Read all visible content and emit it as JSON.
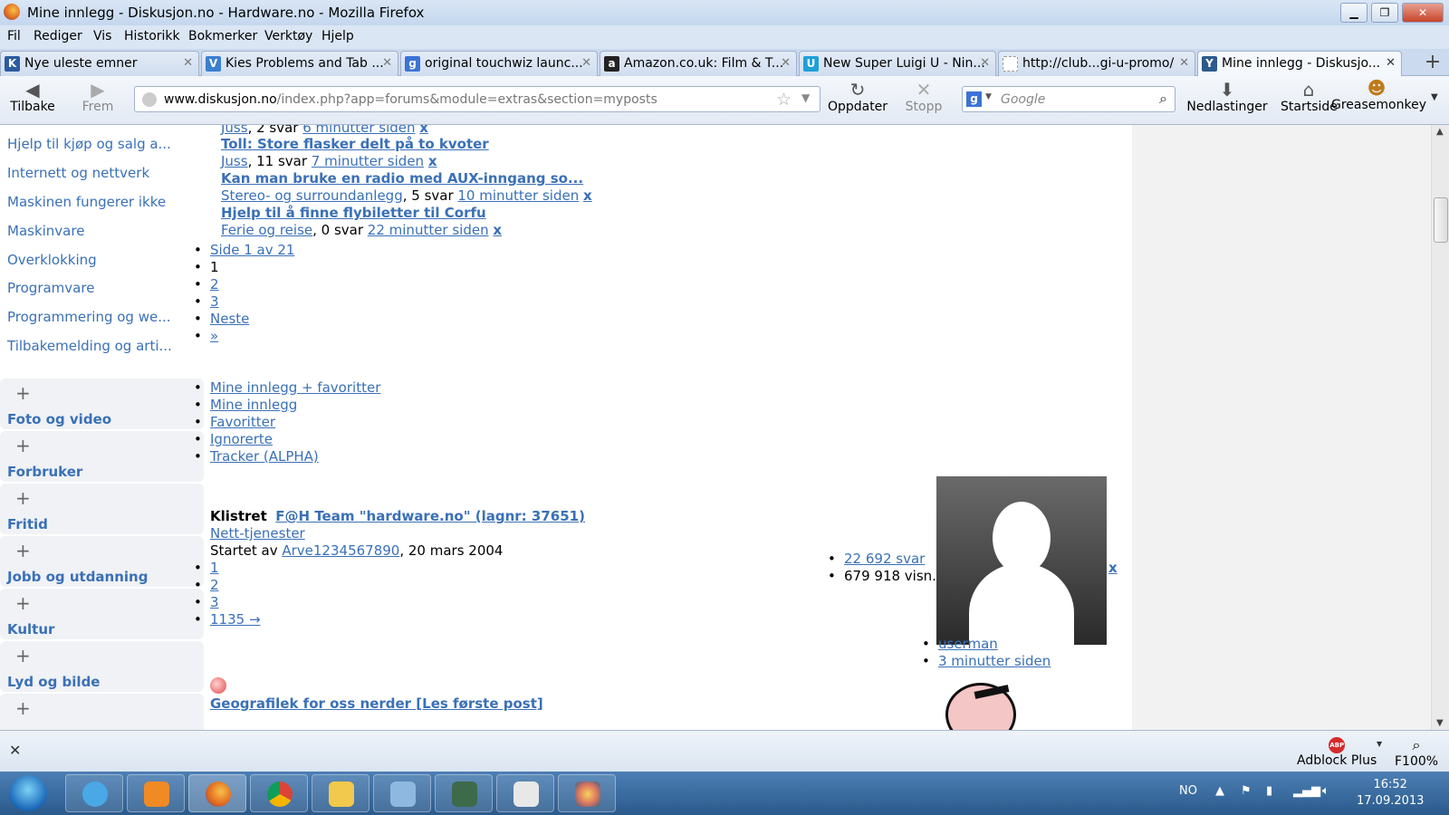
{
  "window": {
    "title": "Mine innlegg - Diskusjon.no - Hardware.no - Mozilla Firefox"
  },
  "menu": [
    "Fil",
    "Rediger",
    "Vis",
    "Historikk",
    "Bokmerker",
    "Verktøy",
    "Hjelp"
  ],
  "tabs": [
    {
      "title": "Nye uleste emner",
      "icon": "K",
      "color": "#2b5aa0"
    },
    {
      "title": "Kies Problems and Tab ...",
      "icon": "V",
      "color": "#3a7fd0"
    },
    {
      "title": "original touchwiz launc...",
      "icon": "g",
      "color": "#3c73d6"
    },
    {
      "title": "Amazon.co.uk: Film & T...",
      "icon": "a",
      "color": "#222222"
    },
    {
      "title": "New Super Luigi U - Nin...",
      "icon": "U",
      "color": "#1ea0d8"
    },
    {
      "title": "http://club...gi-u-promo/",
      "icon": "",
      "color": "#cccccc"
    },
    {
      "title": "Mine innlegg - Diskusjo...",
      "icon": "Y",
      "color": "#2d5a8c"
    }
  ],
  "nav": {
    "back": "Tilbake",
    "forward": "Frem",
    "url_domain": "www.diskusjon.no",
    "url_path": "/index.php?app=forums&module=extras&section=myposts",
    "reload": "Oppdater",
    "stop": "Stopp",
    "search_placeholder": "Google",
    "downloads": "Nedlastinger",
    "home": "Startside",
    "greasemonkey": "Greasemonkey"
  },
  "sidebar": {
    "links": [
      "Hjelp til kjøp og salg a...",
      "Internett og nettverk",
      "Maskinen fungerer ikke",
      "Maskinvare",
      "Overklokking",
      "Programvare",
      "Programmering og we...",
      "Tilbakemelding og arti..."
    ],
    "categories": [
      "Foto og video",
      "Forbruker",
      "Fritid",
      "Jobb og utdanning",
      "Kultur",
      "Lyd og bilde"
    ]
  },
  "posts": [
    {
      "forum": "Juss",
      "replies": ", 2 svar ",
      "time": "6 minutter siden"
    },
    {
      "title": "Toll: Store flasker delt på to kvoter",
      "forum": "Juss",
      "replies": ", 11 svar ",
      "time": "7 minutter siden"
    },
    {
      "title": "Kan man bruke en radio med AUX-inngang so...",
      "forum": "Stereo- og surroundanlegg",
      "replies": ", 5 svar ",
      "time": "10 minutter siden"
    },
    {
      "title": "Hjelp til å finne flybiletter til Corfu",
      "forum": "Ferie og reise",
      "replies": ", 0 svar ",
      "time": "22 minutter siden"
    }
  ],
  "delete_label": "x",
  "pagination": {
    "label": "Side 1 av 21",
    "current": "1",
    "pages": [
      "2",
      "3"
    ],
    "next": "Neste",
    "last": "»"
  },
  "filters": [
    "Mine innlegg + favoritter",
    "Mine innlegg",
    "Favoritter",
    "Ignorerte",
    "Tracker (ALPHA)"
  ],
  "pinned": {
    "tag": "Klistret",
    "title": "F@H Team \"hardware.no\" (lagnr: 37651)",
    "forum": "Nett-tjenester",
    "started_by": "Startet av ",
    "author": "Arve1234567890",
    "date": ", 20 mars 2004",
    "pages": [
      "1",
      "2",
      "3",
      "1135 →"
    ],
    "replies": "22 692 svar",
    "views": "679 918 visn.",
    "last_user": "userman",
    "last_time": "3 minutter siden"
  },
  "next_post_title": "Geografilek for oss nerder [Les første post]",
  "addons": {
    "adblock_label": "Adblock Plus",
    "adblock_icon": "ABP",
    "zoom_label": "F100%"
  },
  "tray": {
    "lang": "NO",
    "time": "16:52",
    "date": "17.09.2013"
  }
}
